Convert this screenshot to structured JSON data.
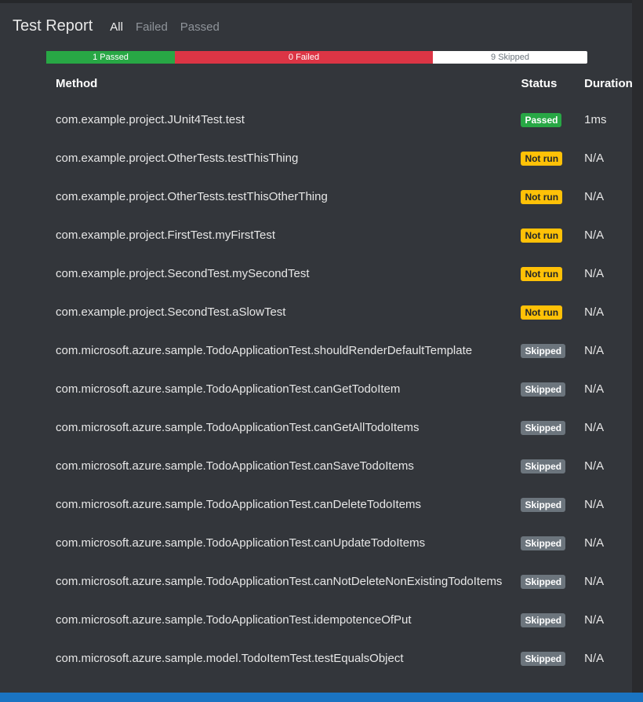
{
  "header": {
    "title": "Test Report",
    "filters": [
      "All",
      "Failed",
      "Passed"
    ],
    "active_filter": "All"
  },
  "summary": {
    "passed_label": "1 Passed",
    "failed_label": "0 Failed",
    "skipped_label": "9 Skipped"
  },
  "table": {
    "columns": [
      "Method",
      "Status",
      "Duration"
    ],
    "rows": [
      {
        "method": "com.example.project.JUnit4Test.test",
        "status": "Passed",
        "duration": "1ms"
      },
      {
        "method": "com.example.project.OtherTests.testThisThing",
        "status": "Not run",
        "duration": "N/A"
      },
      {
        "method": "com.example.project.OtherTests.testThisOtherThing",
        "status": "Not run",
        "duration": "N/A"
      },
      {
        "method": "com.example.project.FirstTest.myFirstTest",
        "status": "Not run",
        "duration": "N/A"
      },
      {
        "method": "com.example.project.SecondTest.mySecondTest",
        "status": "Not run",
        "duration": "N/A"
      },
      {
        "method": "com.example.project.SecondTest.aSlowTest",
        "status": "Not run",
        "duration": "N/A"
      },
      {
        "method": "com.microsoft.azure.sample.TodoApplicationTest.shouldRenderDefaultTemplate",
        "status": "Skipped",
        "duration": "N/A"
      },
      {
        "method": "com.microsoft.azure.sample.TodoApplicationTest.canGetTodoItem",
        "status": "Skipped",
        "duration": "N/A"
      },
      {
        "method": "com.microsoft.azure.sample.TodoApplicationTest.canGetAllTodoItems",
        "status": "Skipped",
        "duration": "N/A"
      },
      {
        "method": "com.microsoft.azure.sample.TodoApplicationTest.canSaveTodoItems",
        "status": "Skipped",
        "duration": "N/A"
      },
      {
        "method": "com.microsoft.azure.sample.TodoApplicationTest.canDeleteTodoItems",
        "status": "Skipped",
        "duration": "N/A"
      },
      {
        "method": "com.microsoft.azure.sample.TodoApplicationTest.canUpdateTodoItems",
        "status": "Skipped",
        "duration": "N/A"
      },
      {
        "method": "com.microsoft.azure.sample.TodoApplicationTest.canNotDeleteNonExistingTodoItems",
        "status": "Skipped",
        "duration": "N/A"
      },
      {
        "method": "com.microsoft.azure.sample.TodoApplicationTest.idempotenceOfPut",
        "status": "Skipped",
        "duration": "N/A"
      },
      {
        "method": "com.microsoft.azure.sample.model.TodoItemTest.testEqualsObject",
        "status": "Skipped",
        "duration": "N/A"
      }
    ]
  },
  "colors": {
    "passed": "#28a745",
    "failed": "#dc3545",
    "not_run": "#ffc107",
    "skipped": "#6c757d",
    "panel_bg": "#33363b",
    "status_bar": "#1a74c2"
  }
}
